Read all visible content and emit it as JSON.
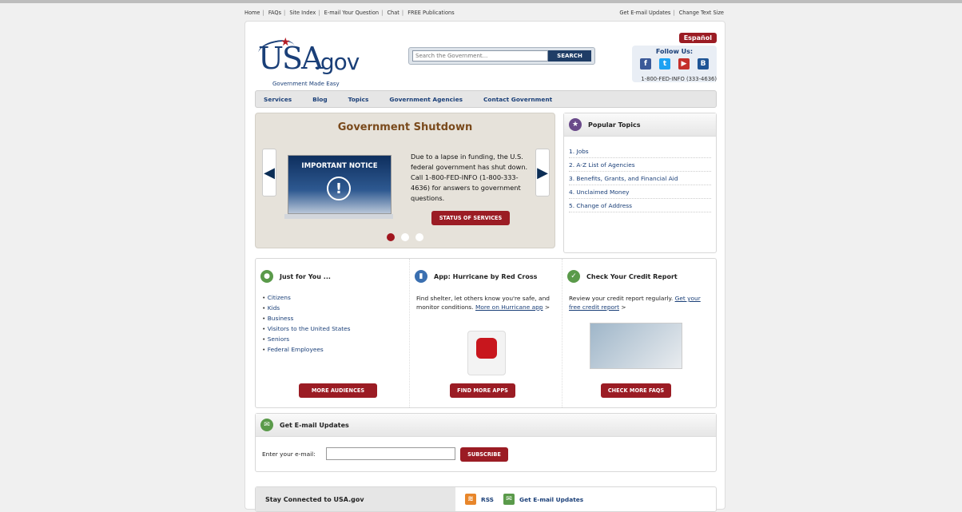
{
  "util_links": {
    "left": [
      "Home",
      "FAQs",
      "Site Index",
      "E-mail Your Question",
      "Chat",
      "FREE Publications"
    ],
    "right": [
      "Get E-mail Updates",
      "Change Text Size"
    ]
  },
  "header": {
    "logo_usa": "USA",
    "logo_gov": ".gov",
    "logo_tag_1": "Government",
    "logo_tag_2": "Made Easy",
    "search_placeholder": "Search the Government...",
    "search_button": "SEARCH",
    "espanol": "Español",
    "follow_label": "Follow Us:",
    "phone": "1-800-FED-INFO (333-4636)"
  },
  "nav": [
    "Services",
    "Blog",
    "Topics",
    "Government Agencies",
    "Contact Government"
  ],
  "carousel": {
    "title": "Government Shutdown",
    "notice_title": "IMPORTANT NOTICE",
    "notice_icon": "!",
    "body": "Due to a lapse in funding, the U.S. federal government has shut down. Call 1-800-FED-INFO (1-800-333-4636) for answers to government questions.",
    "button": "STATUS OF SERVICES"
  },
  "popular": {
    "title": "Popular Topics",
    "items": [
      "1. Jobs",
      "2. A-Z List of Agencies",
      "3. Benefits, Grants, and Financial Aid",
      "4. Unclaimed Money",
      "5. Change of Address"
    ]
  },
  "just_for_you": {
    "title": "Just for You ...",
    "items": [
      "Citizens",
      "Kids",
      "Business",
      "Visitors to the United States",
      "Seniors",
      "Federal Employees"
    ],
    "button": "MORE AUDIENCES"
  },
  "app": {
    "title": "App: Hurricane by Red Cross",
    "text": "Find shelter, let others know you're safe, and monitor conditions.",
    "link": "More on Hurricane app",
    "suffix": ">",
    "button": "FIND MORE APPS"
  },
  "credit": {
    "title": "Check Your Credit Report",
    "text": "Review your credit report regularly.",
    "link": "Get your free credit report",
    "suffix": ">",
    "button": "CHECK MORE FAQS"
  },
  "email": {
    "title": "Get E-mail Updates",
    "label": "Enter your e-mail:",
    "button": "SUBSCRIBE"
  },
  "stay": {
    "title": "Stay Connected to USA.gov",
    "rss": "RSS",
    "updates": "Get E-mail Updates"
  }
}
